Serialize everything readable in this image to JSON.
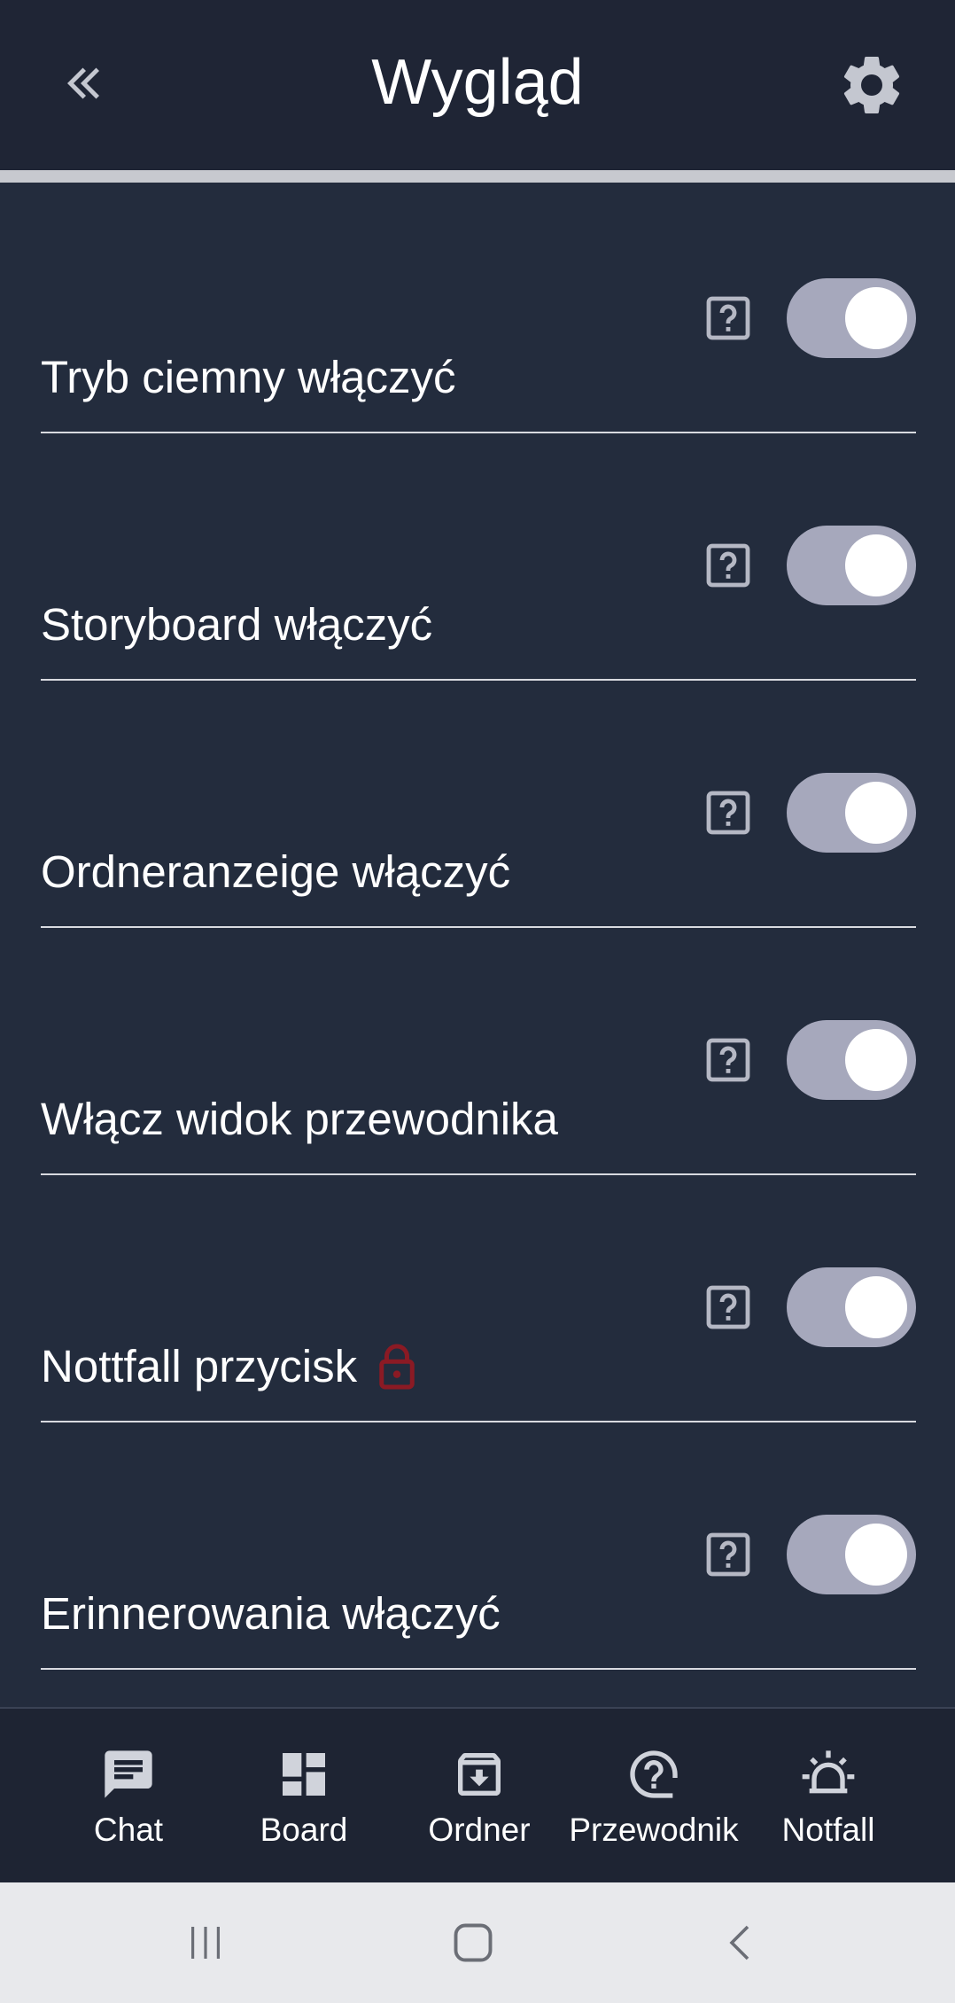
{
  "header": {
    "title": "Wygląd",
    "back_icon": "double-chevron-left-icon",
    "settings_icon": "gear-icon"
  },
  "settings": [
    {
      "label": "Tryb ciemny włączyć",
      "locked": false,
      "enabled": true
    },
    {
      "label": "Storyboard włączyć",
      "locked": false,
      "enabled": true
    },
    {
      "label": "Ordneranzeige włączyć",
      "locked": false,
      "enabled": true
    },
    {
      "label": "Włącz widok przewodnika",
      "locked": false,
      "enabled": true
    },
    {
      "label": "Nottfall przycisk",
      "locked": true,
      "enabled": true
    },
    {
      "label": "Erinnerowania włączyć",
      "locked": false,
      "enabled": true
    }
  ],
  "bottom_nav": [
    {
      "label": "Chat",
      "icon": "chat-icon"
    },
    {
      "label": "Board",
      "icon": "dashboard-icon"
    },
    {
      "label": "Ordner",
      "icon": "archive-icon"
    },
    {
      "label": "Przewodnik",
      "icon": "help-circle-icon"
    },
    {
      "label": "Notfall",
      "icon": "siren-icon"
    }
  ],
  "colors": {
    "background": "#232c3d",
    "header": "#1f2535",
    "toggle_track": "#a6a8bc",
    "lock": "#8b1a24",
    "help_icon": "#b5b8c4"
  }
}
